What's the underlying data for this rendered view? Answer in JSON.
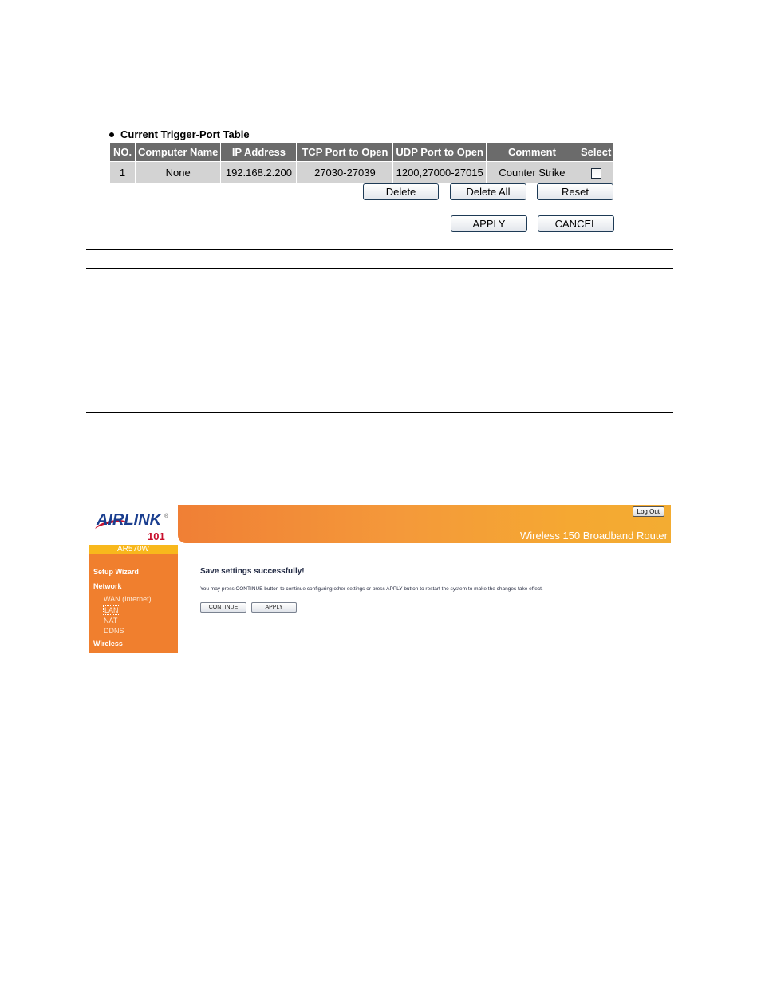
{
  "trigger_port": {
    "section_title": "Current Trigger-Port Table",
    "columns": [
      "NO.",
      "Computer Name",
      "IP Address",
      "TCP Port to Open",
      "UDP Port to Open",
      "Comment",
      "Select"
    ],
    "rows": [
      {
        "no": "1",
        "computer_name": "None",
        "ip_address": "192.168.2.200",
        "tcp_port": "27030-27039",
        "udp_port": "1200,27000-27015",
        "comment": "Counter Strike",
        "selected": false
      }
    ],
    "buttons": {
      "delete": "Delete",
      "delete_all": "Delete All",
      "reset": "Reset",
      "apply": "APPLY",
      "cancel": "CANCEL"
    }
  },
  "router_ui": {
    "brand": {
      "logo_text": "AIRLINK",
      "logo_number": "101",
      "registered": "®"
    },
    "model": "AR570W",
    "product_title": "Wireless 150 Broadband Router",
    "logout_label": "Log Out",
    "sidebar": {
      "items": [
        {
          "label": "Setup Wizard",
          "level": "top"
        },
        {
          "label": "Network",
          "level": "top"
        },
        {
          "label": "WAN (Internet)",
          "level": "sub"
        },
        {
          "label": "LAN",
          "level": "sub",
          "active": true
        },
        {
          "label": "NAT",
          "level": "sub"
        },
        {
          "label": "DDNS",
          "level": "sub"
        },
        {
          "label": "Wireless",
          "level": "top"
        }
      ]
    },
    "content": {
      "title": "Save settings successfully!",
      "message": "You may press CONTINUE button to continue configuring other settings or press APPLY button to restart the system to make the changes take effect.",
      "continue_label": "CONTINUE",
      "apply_label": "APPLY"
    },
    "colors": {
      "sidebar": "#f07f2e",
      "model_bar": "#f8b81c",
      "banner_start": "#f07f35",
      "banner_end": "#f3ac32"
    }
  }
}
